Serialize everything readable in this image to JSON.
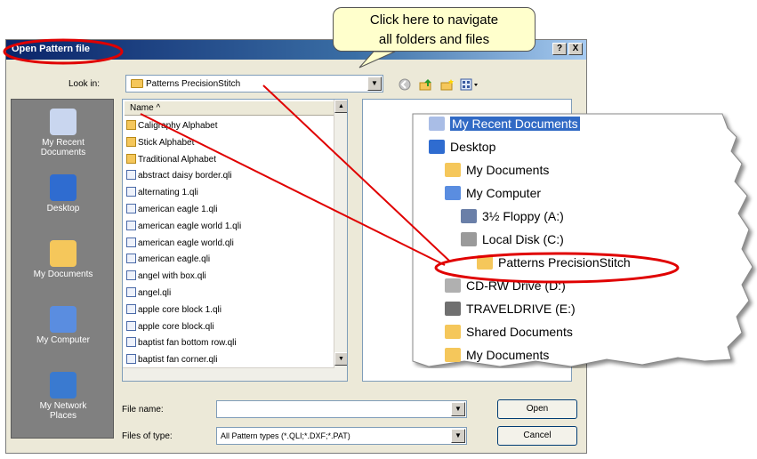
{
  "callout": {
    "line1": "Click here to navigate",
    "line2": "all folders and files"
  },
  "dialog": {
    "title": "Open Pattern file",
    "help_btn": "?",
    "close_btn": "X",
    "lookin_label": "Look in:",
    "lookin_value": "Patterns PrecisionStitch"
  },
  "places": [
    {
      "label1": "My Recent",
      "label2": "Documents"
    },
    {
      "label1": "Desktop",
      "label2": ""
    },
    {
      "label1": "My Documents",
      "label2": ""
    },
    {
      "label1": "My Computer",
      "label2": ""
    },
    {
      "label1": "My Network",
      "label2": "Places"
    }
  ],
  "filelist": {
    "header": "Name  ^",
    "items": [
      {
        "name": "Caligraphy Alphabet",
        "kind": "folder"
      },
      {
        "name": "Stick Alphabet",
        "kind": "folder"
      },
      {
        "name": "Traditional Alphabet",
        "kind": "folder"
      },
      {
        "name": "abstract daisy border.qli",
        "kind": "file"
      },
      {
        "name": "alternating 1.qli",
        "kind": "file"
      },
      {
        "name": "american eagle 1.qli",
        "kind": "file"
      },
      {
        "name": "american eagle world 1.qli",
        "kind": "file"
      },
      {
        "name": "american eagle world.qli",
        "kind": "file"
      },
      {
        "name": "american eagle.qli",
        "kind": "file"
      },
      {
        "name": "angel with box.qli",
        "kind": "file"
      },
      {
        "name": "angel.qli",
        "kind": "file"
      },
      {
        "name": "apple core block 1.qli",
        "kind": "file"
      },
      {
        "name": "apple core block.qli",
        "kind": "file"
      },
      {
        "name": "baptist fan bottom row.qli",
        "kind": "file"
      },
      {
        "name": "baptist fan corner.qli",
        "kind": "file"
      }
    ]
  },
  "filename": {
    "label": "File name:",
    "value": ""
  },
  "filetype": {
    "label": "Files of type:",
    "value": "All Pattern types (*.QLI;*.DXF;*.PAT)"
  },
  "buttons": {
    "open": "Open",
    "cancel": "Cancel"
  },
  "tree": [
    {
      "label": "My Recent Documents",
      "icon": "recent-docs-icon",
      "selected": true
    },
    {
      "label": "Desktop",
      "icon": "desktop-icon"
    },
    {
      "label": "My Documents",
      "icon": "my-documents-icon"
    },
    {
      "label": "My Computer",
      "icon": "my-computer-icon"
    },
    {
      "label": "3½ Floppy (A:)",
      "icon": "floppy-icon"
    },
    {
      "label": "Local Disk (C:)",
      "icon": "local-disk-icon"
    },
    {
      "label": "Patterns PrecisionStitch",
      "icon": "folder-icon"
    },
    {
      "label": "CD-RW Drive (D:)",
      "icon": "cd-drive-icon"
    },
    {
      "label": "TRAVELDRIVE (E:)",
      "icon": "removable-drive-icon"
    },
    {
      "label": "Shared Documents",
      "icon": "folder-icon"
    },
    {
      "label": "My Documents",
      "icon": "folder-icon"
    }
  ],
  "colors": {
    "annotation_red": "#e00000",
    "title_blue": "#0a246a",
    "callout_bg": "#ffffcc",
    "selection": "#316ac5"
  }
}
